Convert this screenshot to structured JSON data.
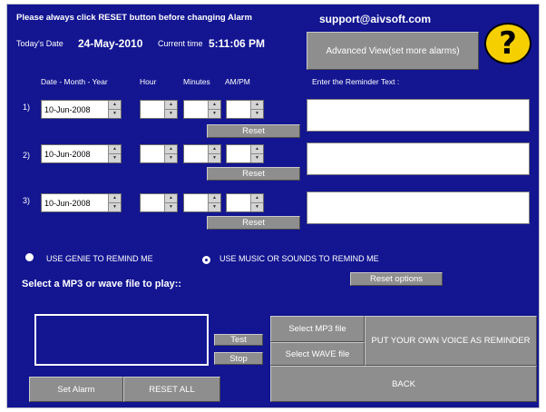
{
  "header": {
    "notice": "Please always click RESET button before changing Alarm",
    "support_email": "support@aivsoft.com",
    "date_label": "Today's Date",
    "date_value": "24-May-2010",
    "time_label": "Current time",
    "time_value": "5:11:06 PM",
    "advanced_button": "Advanced View(set more alarms)",
    "help_symbol": "?"
  },
  "columns": {
    "date": "Date - Month - Year",
    "hour": "Hour",
    "minutes": "Minutes",
    "ampm": "AM/PM",
    "reminder": "Enter the Reminder Text :"
  },
  "alarms": [
    {
      "index": "1)",
      "date": "10-Jun-2008",
      "hour": "",
      "minutes": "",
      "ampm": "",
      "reset": "Reset",
      "text": ""
    },
    {
      "index": "2)",
      "date": "10-Jun-2008",
      "hour": "",
      "minutes": "",
      "ampm": "",
      "reset": "Reset",
      "text": ""
    },
    {
      "index": "3)",
      "date": "10-Jun-2008",
      "hour": "",
      "minutes": "",
      "ampm": "",
      "reset": "Reset",
      "text": ""
    }
  ],
  "options": {
    "genie": "USE GENIE TO REMIND ME",
    "music": "USE MUSIC OR SOUNDS TO REMIND ME",
    "selected": "music",
    "select_file_label": "Select a MP3 or wave  file to play::",
    "reset_options": "Reset options"
  },
  "bottom": {
    "test": "Test",
    "stop": "Stop",
    "select_mp3": "Select MP3  file",
    "select_wave": "Select WAVE  file",
    "own_voice": "PUT YOUR OWN VOICE AS REMINDER",
    "back": "BACK",
    "set_alarm": "Set Alarm",
    "reset_all": "RESET ALL"
  },
  "colors": {
    "background": "#131591",
    "button": "#8e8e8e",
    "help_yellow": "#f5cf00"
  }
}
